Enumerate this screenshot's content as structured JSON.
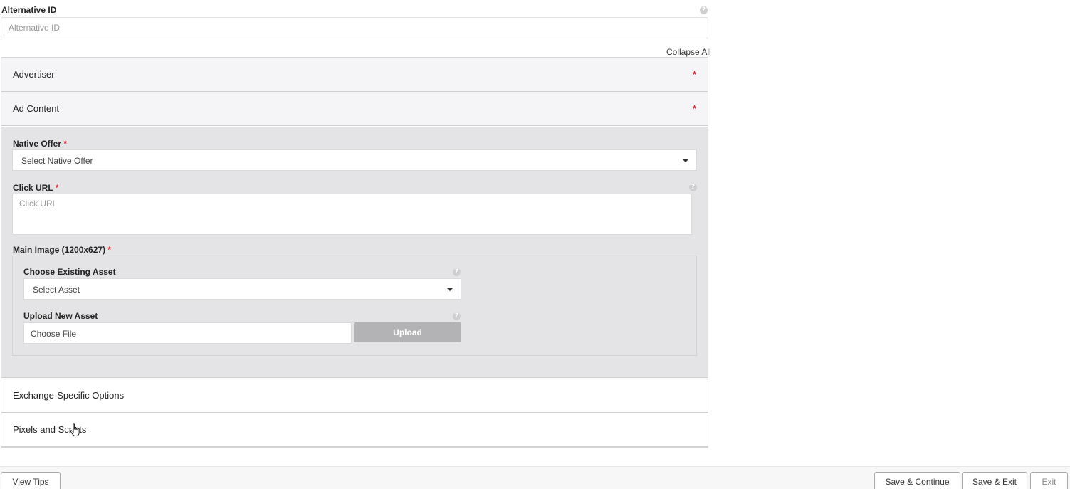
{
  "alternative_id": {
    "label": "Alternative ID",
    "placeholder": "Alternative ID",
    "value": ""
  },
  "collapse_all": "Collapse All",
  "required_marker": "*",
  "help_glyph": "?",
  "sections": [
    {
      "title": "Advertiser",
      "required": true
    },
    {
      "title": "Ad Content",
      "required": true,
      "expanded": true
    },
    {
      "title": "Exchange-Specific Options",
      "required": false
    },
    {
      "title": "Pixels and Scripts",
      "required": false
    }
  ],
  "ad_content": {
    "native_offer": {
      "label": "Native Offer",
      "selected": "Select Native Offer"
    },
    "click_url": {
      "label": "Click URL",
      "placeholder": "Click URL"
    },
    "main_image": {
      "label": "Main Image (1200x627)",
      "existing_asset": {
        "label": "Choose Existing Asset",
        "selected": "Select Asset"
      },
      "upload_asset": {
        "label": "Upload New Asset",
        "file_text": "Choose File",
        "upload_label": "Upload"
      }
    }
  },
  "footer": {
    "view_tips": "View Tips",
    "save_continue": "Save & Continue",
    "save_exit": "Save & Exit",
    "exit": "Exit"
  },
  "colors": {
    "required": "#d9262b",
    "section_header_bg": "#f5f5f7",
    "expanded_body_bg": "#e4e4e6",
    "upload_button_bg": "#b3b3b5"
  }
}
